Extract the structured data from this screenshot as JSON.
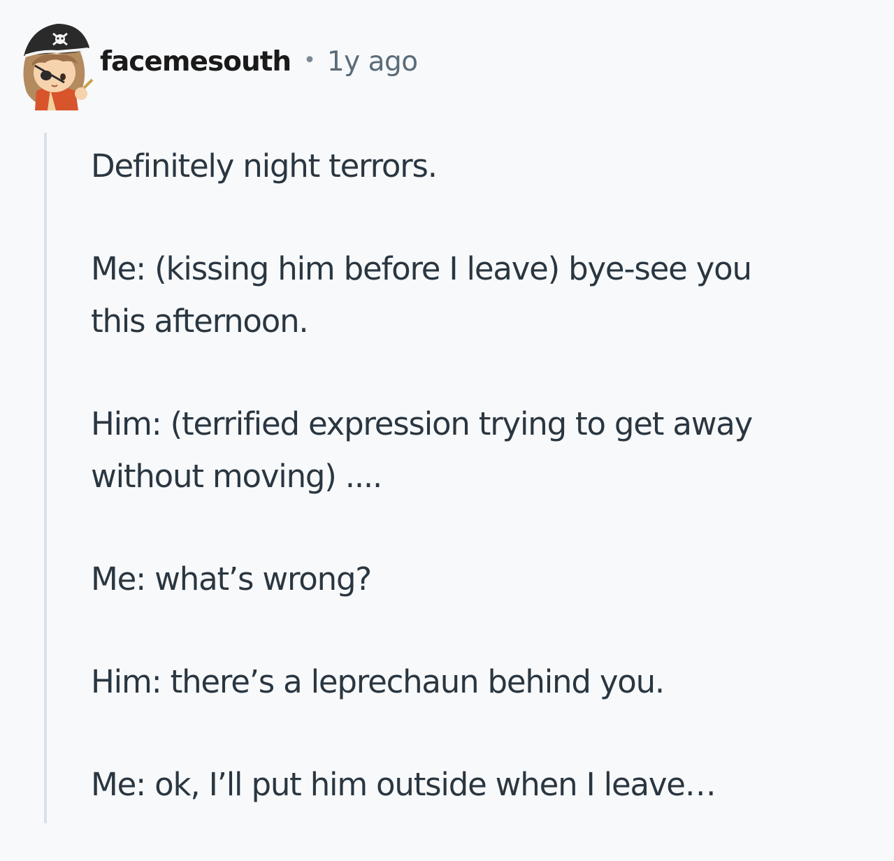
{
  "comment": {
    "author": "facemesouth",
    "separator": "•",
    "age": "1y ago",
    "avatar_icon": "pirate-avatar-icon",
    "paragraphs": [
      [
        "Definitely night terrors."
      ],
      [
        "Me: (kissing him before I leave) bye-see you",
        "this afternoon."
      ],
      [
        "Him: (terrified expression trying to get away",
        "without moving) ...."
      ],
      [
        "Me: what’s wrong?"
      ],
      [
        "Him: there’s a leprechaun behind you."
      ],
      [
        "Me: ok, I’ll put him outside when I leave…"
      ]
    ]
  },
  "colors": {
    "background": "#f7f9fb",
    "text": "#2a3640",
    "meta": "#5b6b78",
    "thread_line": "#d9e1e8"
  }
}
